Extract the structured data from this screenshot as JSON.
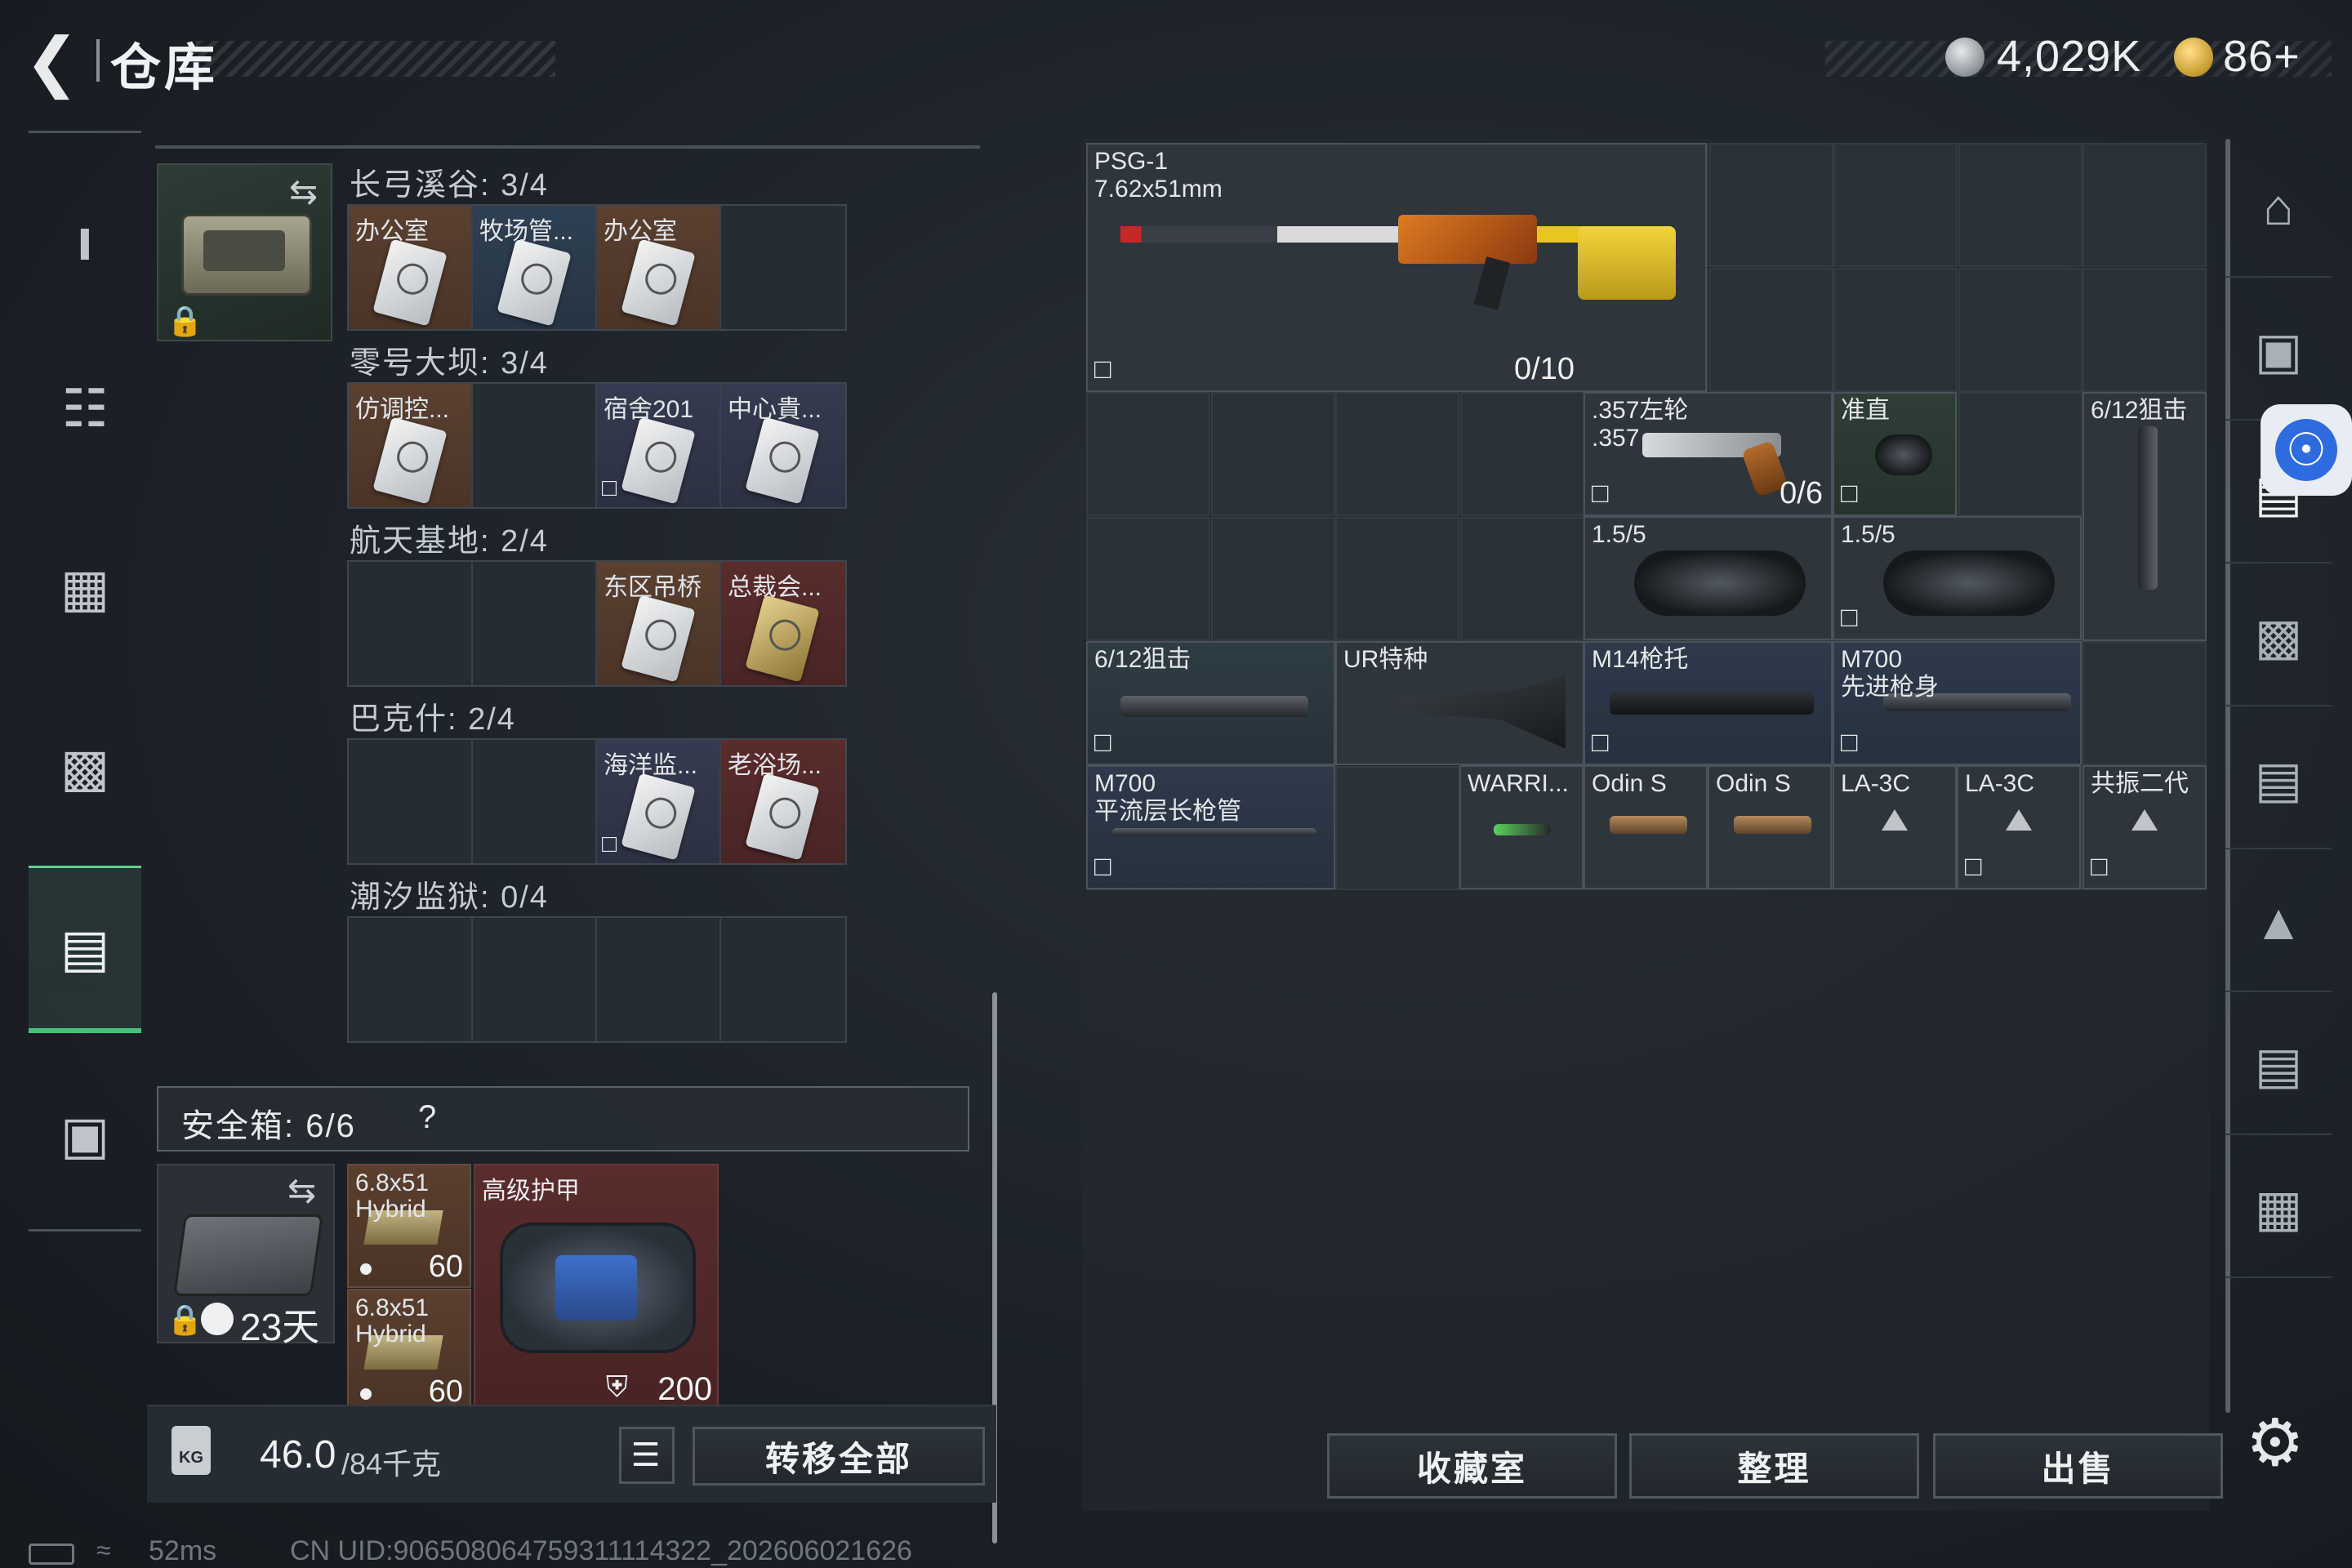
{
  "header": {
    "title": "仓库",
    "currency_silver": "4,029K",
    "currency_gold": "86+"
  },
  "left_nav": {
    "items": [
      "pistol-icon",
      "armor-icon",
      "backpack-icon",
      "rig-icon",
      "case-icon",
      "toolbox-icon"
    ],
    "active_index": 4
  },
  "key_groups": [
    {
      "title": "长弓溪谷: 3/4",
      "slots": [
        {
          "label": "办公室",
          "rarity": "orange"
        },
        {
          "label": "牧场管...",
          "rarity": "blue"
        },
        {
          "label": "办公室",
          "rarity": "orange"
        },
        {
          "label": "",
          "rarity": "empty"
        }
      ]
    },
    {
      "title": "零号大坝: 3/4",
      "slots": [
        {
          "label": "仿调控...",
          "rarity": "orange"
        },
        {
          "label": "",
          "rarity": "empty"
        },
        {
          "label": "宿舍201",
          "rarity": "purple",
          "locked": true
        },
        {
          "label": "中心貴...",
          "rarity": "purple"
        }
      ]
    },
    {
      "title": "航天基地: 2/4",
      "slots": [
        {
          "label": "",
          "rarity": "empty"
        },
        {
          "label": "",
          "rarity": "empty"
        },
        {
          "label": "东区吊桥",
          "rarity": "orange"
        },
        {
          "label": "总裁会...",
          "rarity": "red",
          "gold": true
        }
      ]
    },
    {
      "title": "巴克什: 2/4",
      "slots": [
        {
          "label": "",
          "rarity": "empty"
        },
        {
          "label": "",
          "rarity": "empty"
        },
        {
          "label": "海洋监...",
          "rarity": "purple",
          "locked": true
        },
        {
          "label": "老浴场...",
          "rarity": "red"
        }
      ]
    },
    {
      "title": "潮汐监狱: 0/4",
      "slots": [
        {
          "label": "",
          "rarity": "empty"
        },
        {
          "label": "",
          "rarity": "empty"
        },
        {
          "label": "",
          "rarity": "empty"
        },
        {
          "label": "",
          "rarity": "empty"
        }
      ]
    }
  ],
  "safe_box": {
    "title": "安全箱: 6/6",
    "help": "?",
    "days": "23天",
    "ammo": [
      {
        "label": "6.8x51 Hybrid",
        "count": "60"
      },
      {
        "label": "6.8x51 Hybrid",
        "count": "60"
      }
    ],
    "armor": {
      "label": "高级护甲",
      "value": "200"
    }
  },
  "footer_left": {
    "weight": "46.0",
    "weight_max": "/84千克",
    "transfer_all": "转移全部"
  },
  "grid_items": {
    "psg1": {
      "name": "PSG-1",
      "caliber": "7.62x51mm",
      "count": "0/10"
    },
    "revolver": {
      "name": ".357左轮",
      "caliber": ".357",
      "count": "0/6"
    },
    "sight": {
      "label": "准直"
    },
    "scope_tall": {
      "label": "6/12狙击"
    },
    "scope1": {
      "label": "1.5/5"
    },
    "scope2": {
      "label": "1.5/5"
    },
    "scope_long": {
      "label": "6/12狙击"
    },
    "stock_ur": {
      "label": "UR特种"
    },
    "stock_m14": {
      "label": "M14枪托"
    },
    "m700_body": {
      "label": "M700",
      "sub": "先进枪身"
    },
    "m700_barrel": {
      "label": "M700",
      "sub": "平流层长枪管"
    },
    "warri": {
      "label": "WARRI..."
    },
    "odin1": {
      "label": "Odin S"
    },
    "odin2": {
      "label": "Odin S"
    },
    "la3c1": {
      "label": "LA-3C"
    },
    "la3c2": {
      "label": "LA-3C"
    },
    "resonance": {
      "label": "共振二代"
    }
  },
  "bottom_buttons": {
    "collection": "收藏室",
    "sort": "整理",
    "sell": "出售"
  },
  "right_nav": [
    "home-icon",
    "weapon-workshop-icon",
    "rifle-rack-icon",
    "vehicle-icon",
    "rifle-rack-2-icon",
    "armory-icon",
    "rifle-rack-3-icon",
    "storage-icon"
  ],
  "status_bar": {
    "ping": "52ms",
    "uid": "CN UID:906508064759311114322_202606021626"
  },
  "colors": {
    "accent_green": "#47c07a",
    "rarity_orange": "#5a4030",
    "rarity_blue": "#2e4052",
    "rarity_purple": "#353b50",
    "rarity_red": "#5a2c2c"
  }
}
